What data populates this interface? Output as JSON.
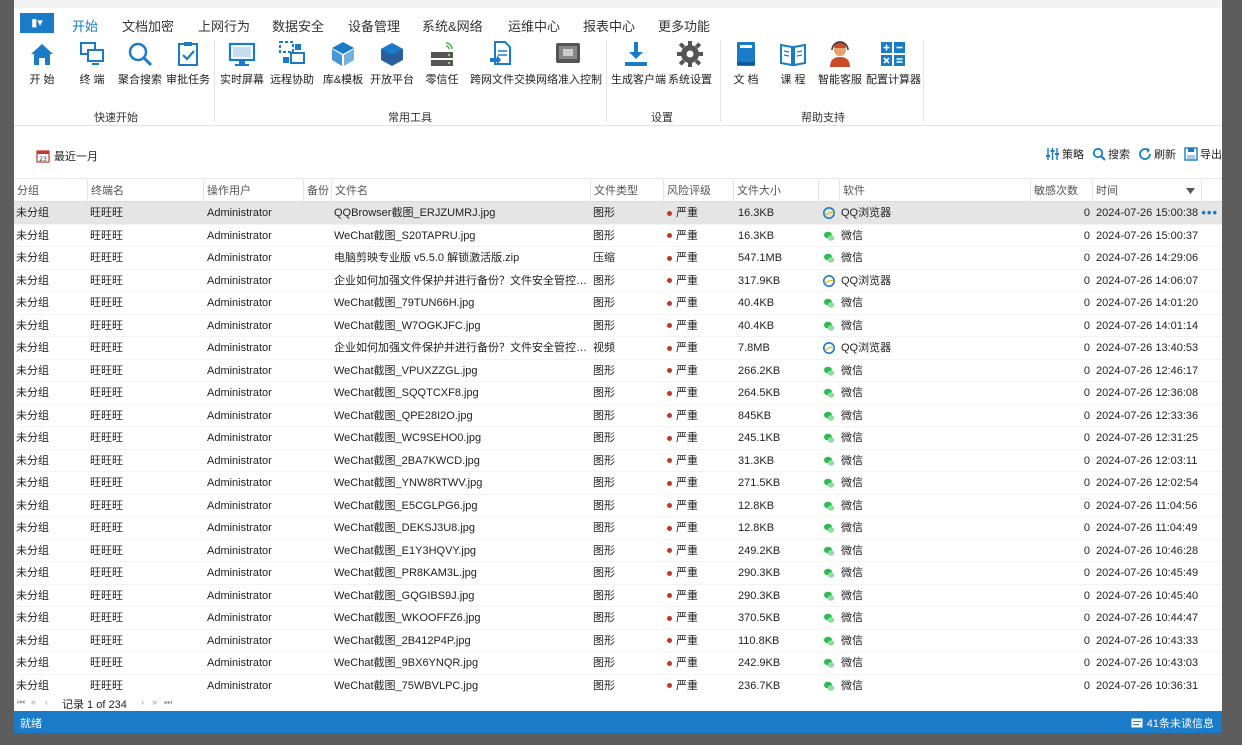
{
  "menu": {
    "app_button": "▮▾",
    "tabs": [
      "开始",
      "文档加密",
      "上网行为",
      "数据安全",
      "设备管理",
      "系统&网络",
      "运维中心",
      "报表中心",
      "更多功能"
    ]
  },
  "ribbon": {
    "buttons": [
      {
        "label": "开 始",
        "icon": "home-icon"
      },
      {
        "label": "终 端",
        "icon": "terminal-icon"
      },
      {
        "label": "聚合搜索",
        "icon": "search-icon"
      },
      {
        "label": "审批任务",
        "icon": "checklist-icon"
      },
      {
        "label": "实时屏幕",
        "icon": "monitor-icon"
      },
      {
        "label": "远程协助",
        "icon": "remote-icon"
      },
      {
        "label": "库&模板",
        "icon": "cube-icon"
      },
      {
        "label": "开放平台",
        "icon": "platform-icon"
      },
      {
        "label": "零信任",
        "icon": "server-icon"
      },
      {
        "label": "跨网文件交换",
        "icon": "file-exchange-icon"
      },
      {
        "label": "网络准入控制",
        "icon": "network-icon"
      },
      {
        "label": "生成客户端",
        "icon": "download-icon"
      },
      {
        "label": "系统设置",
        "icon": "gear-icon"
      },
      {
        "label": "文 档",
        "icon": "book-icon"
      },
      {
        "label": "课 程",
        "icon": "open-book-icon"
      },
      {
        "label": "智能客服",
        "icon": "support-icon"
      },
      {
        "label": "配置计算器",
        "icon": "calculator-icon"
      }
    ],
    "groups": [
      "快速开始",
      "常用工具",
      "设置",
      "帮助支持"
    ]
  },
  "toolbar": {
    "date_range": "最近一月",
    "strategy": "策略",
    "search": "搜索",
    "refresh": "刷新",
    "export": "导出"
  },
  "grid": {
    "columns": [
      "分组",
      "终端名",
      "操作用户",
      "备份",
      "文件名",
      "文件类型",
      "风险评级",
      "文件大小",
      "软件",
      "敏感次数",
      "时间"
    ],
    "rows": [
      {
        "group": "未分组",
        "terminal": "旺旺旺",
        "user": "Administrator",
        "file": "QQBrowser截图_ERJZUMRJ.jpg",
        "type": "图形",
        "risk": "严重",
        "size": "16.3KB",
        "software": "QQ浏览器",
        "sw_icon": "qq-browser-icon",
        "count": "0",
        "time": "2024-07-26 15:00:38"
      },
      {
        "group": "未分组",
        "terminal": "旺旺旺",
        "user": "Administrator",
        "file": "WeChat截图_S20TAPRU.jpg",
        "type": "图形",
        "risk": "严重",
        "size": "16.3KB",
        "software": "微信",
        "sw_icon": "wechat-icon",
        "count": "0",
        "time": "2024-07-26 15:00:37"
      },
      {
        "group": "未分组",
        "terminal": "旺旺旺",
        "user": "Administrator",
        "file": "电脑剪映专业版 v5.5.0 解锁激活版.zip",
        "type": "压缩",
        "risk": "严重",
        "size": "547.1MB",
        "software": "微信",
        "sw_icon": "wechat-icon",
        "count": "0",
        "time": "2024-07-26 14:29:06"
      },
      {
        "group": "未分组",
        "terminal": "旺旺旺",
        "user": "Administrator",
        "file": "企业如何加强文件保护并进行备份？文件安全管控软件...",
        "type": "图形",
        "risk": "严重",
        "size": "317.9KB",
        "software": "QQ浏览器",
        "sw_icon": "qq-browser-icon",
        "count": "0",
        "time": "2024-07-26 14:06:07"
      },
      {
        "group": "未分组",
        "terminal": "旺旺旺",
        "user": "Administrator",
        "file": "WeChat截图_79TUN66H.jpg",
        "type": "图形",
        "risk": "严重",
        "size": "40.4KB",
        "software": "微信",
        "sw_icon": "wechat-icon",
        "count": "0",
        "time": "2024-07-26 14:01:20"
      },
      {
        "group": "未分组",
        "terminal": "旺旺旺",
        "user": "Administrator",
        "file": "WeChat截图_W7OGKJFC.jpg",
        "type": "图形",
        "risk": "严重",
        "size": "40.4KB",
        "software": "微信",
        "sw_icon": "wechat-icon",
        "count": "0",
        "time": "2024-07-26 14:01:14"
      },
      {
        "group": "未分组",
        "terminal": "旺旺旺",
        "user": "Administrator",
        "file": "企业如何加强文件保护并进行备份？文件安全管控软件...",
        "type": "视频",
        "risk": "严重",
        "size": "7.8MB",
        "software": "QQ浏览器",
        "sw_icon": "qq-browser-icon",
        "count": "0",
        "time": "2024-07-26 13:40:53"
      },
      {
        "group": "未分组",
        "terminal": "旺旺旺",
        "user": "Administrator",
        "file": "WeChat截图_VPUXZZGL.jpg",
        "type": "图形",
        "risk": "严重",
        "size": "266.2KB",
        "software": "微信",
        "sw_icon": "wechat-icon",
        "count": "0",
        "time": "2024-07-26 12:46:17"
      },
      {
        "group": "未分组",
        "terminal": "旺旺旺",
        "user": "Administrator",
        "file": "WeChat截图_SQQTCXF8.jpg",
        "type": "图形",
        "risk": "严重",
        "size": "264.5KB",
        "software": "微信",
        "sw_icon": "wechat-icon",
        "count": "0",
        "time": "2024-07-26 12:36:08"
      },
      {
        "group": "未分组",
        "terminal": "旺旺旺",
        "user": "Administrator",
        "file": "WeChat截图_QPE28I2O.jpg",
        "type": "图形",
        "risk": "严重",
        "size": "845KB",
        "software": "微信",
        "sw_icon": "wechat-icon",
        "count": "0",
        "time": "2024-07-26 12:33:36"
      },
      {
        "group": "未分组",
        "terminal": "旺旺旺",
        "user": "Administrator",
        "file": "WeChat截图_WC9SEHO0.jpg",
        "type": "图形",
        "risk": "严重",
        "size": "245.1KB",
        "software": "微信",
        "sw_icon": "wechat-icon",
        "count": "0",
        "time": "2024-07-26 12:31:25"
      },
      {
        "group": "未分组",
        "terminal": "旺旺旺",
        "user": "Administrator",
        "file": "WeChat截图_2BA7KWCD.jpg",
        "type": "图形",
        "risk": "严重",
        "size": "31.3KB",
        "software": "微信",
        "sw_icon": "wechat-icon",
        "count": "0",
        "time": "2024-07-26 12:03:11"
      },
      {
        "group": "未分组",
        "terminal": "旺旺旺",
        "user": "Administrator",
        "file": "WeChat截图_YNW8RTWV.jpg",
        "type": "图形",
        "risk": "严重",
        "size": "271.5KB",
        "software": "微信",
        "sw_icon": "wechat-icon",
        "count": "0",
        "time": "2024-07-26 12:02:54"
      },
      {
        "group": "未分组",
        "terminal": "旺旺旺",
        "user": "Administrator",
        "file": "WeChat截图_E5CGLPG6.jpg",
        "type": "图形",
        "risk": "严重",
        "size": "12.8KB",
        "software": "微信",
        "sw_icon": "wechat-icon",
        "count": "0",
        "time": "2024-07-26 11:04:56"
      },
      {
        "group": "未分组",
        "terminal": "旺旺旺",
        "user": "Administrator",
        "file": "WeChat截图_DEKSJ3U8.jpg",
        "type": "图形",
        "risk": "严重",
        "size": "12.8KB",
        "software": "微信",
        "sw_icon": "wechat-icon",
        "count": "0",
        "time": "2024-07-26 11:04:49"
      },
      {
        "group": "未分组",
        "terminal": "旺旺旺",
        "user": "Administrator",
        "file": "WeChat截图_E1Y3HQVY.jpg",
        "type": "图形",
        "risk": "严重",
        "size": "249.2KB",
        "software": "微信",
        "sw_icon": "wechat-icon",
        "count": "0",
        "time": "2024-07-26 10:46:28"
      },
      {
        "group": "未分组",
        "terminal": "旺旺旺",
        "user": "Administrator",
        "file": "WeChat截图_PR8KAM3L.jpg",
        "type": "图形",
        "risk": "严重",
        "size": "290.3KB",
        "software": "微信",
        "sw_icon": "wechat-icon",
        "count": "0",
        "time": "2024-07-26 10:45:49"
      },
      {
        "group": "未分组",
        "terminal": "旺旺旺",
        "user": "Administrator",
        "file": "WeChat截图_GQGIBS9J.jpg",
        "type": "图形",
        "risk": "严重",
        "size": "290.3KB",
        "software": "微信",
        "sw_icon": "wechat-icon",
        "count": "0",
        "time": "2024-07-26 10:45:40"
      },
      {
        "group": "未分组",
        "terminal": "旺旺旺",
        "user": "Administrator",
        "file": "WeChat截图_WKOOFFZ6.jpg",
        "type": "图形",
        "risk": "严重",
        "size": "370.5KB",
        "software": "微信",
        "sw_icon": "wechat-icon",
        "count": "0",
        "time": "2024-07-26 10:44:47"
      },
      {
        "group": "未分组",
        "terminal": "旺旺旺",
        "user": "Administrator",
        "file": "WeChat截图_2B412P4P.jpg",
        "type": "图形",
        "risk": "严重",
        "size": "110.8KB",
        "software": "微信",
        "sw_icon": "wechat-icon",
        "count": "0",
        "time": "2024-07-26 10:43:33"
      },
      {
        "group": "未分组",
        "terminal": "旺旺旺",
        "user": "Administrator",
        "file": "WeChat截图_9BX6YNQR.jpg",
        "type": "图形",
        "risk": "严重",
        "size": "242.9KB",
        "software": "微信",
        "sw_icon": "wechat-icon",
        "count": "0",
        "time": "2024-07-26 10:43:03"
      },
      {
        "group": "未分组",
        "terminal": "旺旺旺",
        "user": "Administrator",
        "file": "WeChat截图_75WBVLPC.jpg",
        "type": "图形",
        "risk": "严重",
        "size": "236.7KB",
        "software": "微信",
        "sw_icon": "wechat-icon",
        "count": "0",
        "time": "2024-07-26 10:36:31"
      }
    ]
  },
  "pager": {
    "text": "记录 1 of 234"
  },
  "status": {
    "left": "就绪",
    "right": "41条未读信息"
  },
  "colors": {
    "accent": "#1a7cc8",
    "risk": "#c0392b",
    "wechat": "#2bbd4f"
  }
}
